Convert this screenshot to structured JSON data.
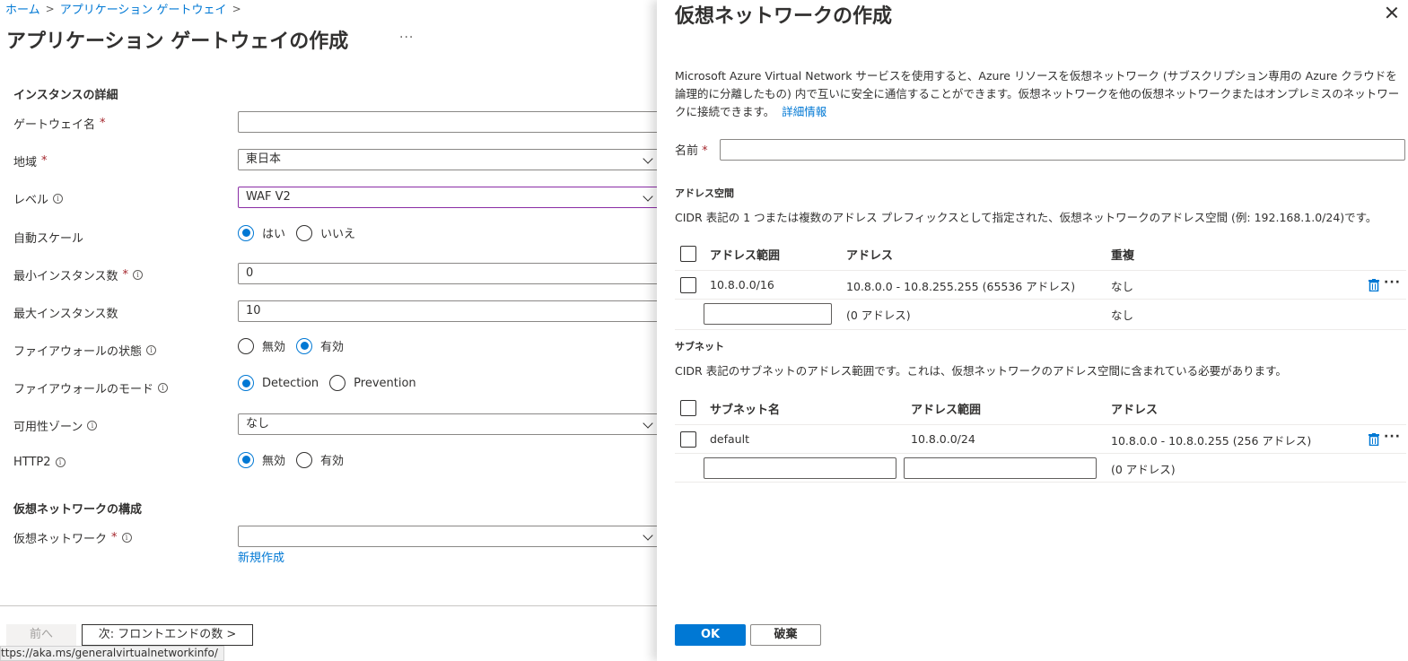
{
  "breadcrumb": {
    "home": "ホーム",
    "sep": ">",
    "item": "アプリケーション ゲートウェイ"
  },
  "page": {
    "title": "アプリケーション ゲートウェイの作成",
    "more": "···"
  },
  "instance": {
    "heading": "インスタンスの詳細",
    "gateway_name_label": "ゲートウェイ名",
    "gateway_name_value": "",
    "region_label": "地域",
    "region_value": "東日本",
    "tier_label": "レベル",
    "tier_value": "WAF V2",
    "autoscale_label": "自動スケール",
    "autoscale_yes": "はい",
    "autoscale_no": "いいえ",
    "min_label": "最小インスタンス数",
    "min_value": "0",
    "max_label": "最大インスタンス数",
    "max_value": "10",
    "fw_status_label": "ファイアウォールの状態",
    "fw_status_off": "無効",
    "fw_status_on": "有効",
    "fw_mode_label": "ファイアウォールのモード",
    "fw_mode_detection": "Detection",
    "fw_mode_prevention": "Prevention",
    "zone_label": "可用性ゾーン",
    "zone_value": "なし",
    "http2_label": "HTTP2",
    "http2_off": "無効",
    "http2_on": "有効",
    "required_mark": "*",
    "info_glyph": "i"
  },
  "vnet_config": {
    "heading": "仮想ネットワークの構成",
    "vnet_label": "仮想ネットワーク",
    "vnet_value": "",
    "create_new": "新規作成"
  },
  "footer": {
    "prev": "前へ",
    "next": "次: フロントエンドの数 >",
    "status_url": "ttps://aka.ms/generalvirtualnetworkinfo/"
  },
  "panel": {
    "title": "仮想ネットワークの作成",
    "description": "Microsoft Azure Virtual Network サービスを使用すると、Azure リソースを仮想ネットワーク (サブスクリプション専用の Azure クラウドを論理的に分離したもの) 内で互いに安全に通信することができます。仮想ネットワークを他の仮想ネットワークまたはオンプレミスのネットワークに接続できます。",
    "learn_more": "詳細情報",
    "name_label": "名前",
    "name_value": "",
    "address_space": {
      "heading": "アドレス空間",
      "description": "CIDR 表記の 1 つまたは複数のアドレス プレフィックスとして指定された、仮想ネットワークのアドレス空間 (例: 192.168.1.0/24)です。",
      "columns": [
        "アドレス範囲",
        "アドレス",
        "重複"
      ],
      "rows": [
        {
          "range": "10.8.0.0/16",
          "addresses": "10.8.0.0 - 10.8.255.255 (65536 アドレス)",
          "overlap": "なし"
        }
      ],
      "new_row": {
        "range": "",
        "addresses": "(0 アドレス)",
        "overlap": "なし"
      }
    },
    "subnets": {
      "heading": "サブネット",
      "description": "CIDR 表記のサブネットのアドレス範囲です。これは、仮想ネットワークのアドレス空間に含まれている必要があります。",
      "columns": [
        "サブネット名",
        "アドレス範囲",
        "アドレス"
      ],
      "rows": [
        {
          "name": "default",
          "range": "10.8.0.0/24",
          "addresses": "10.8.0.0 - 10.8.0.255 (256 アドレス)"
        }
      ],
      "new_row": {
        "name": "",
        "range": "",
        "addresses": "(0 アドレス)"
      }
    },
    "ok": "OK",
    "discard": "破棄",
    "more_glyph": "···"
  },
  "colors": {
    "accent": "#0078d4",
    "required": "#a4262c",
    "focus_border": "#8a2da5",
    "trash": "#0078d4"
  },
  "icons": [
    "chevron-down-icon",
    "info-icon",
    "close-icon",
    "trash-icon",
    "more-icon"
  ]
}
